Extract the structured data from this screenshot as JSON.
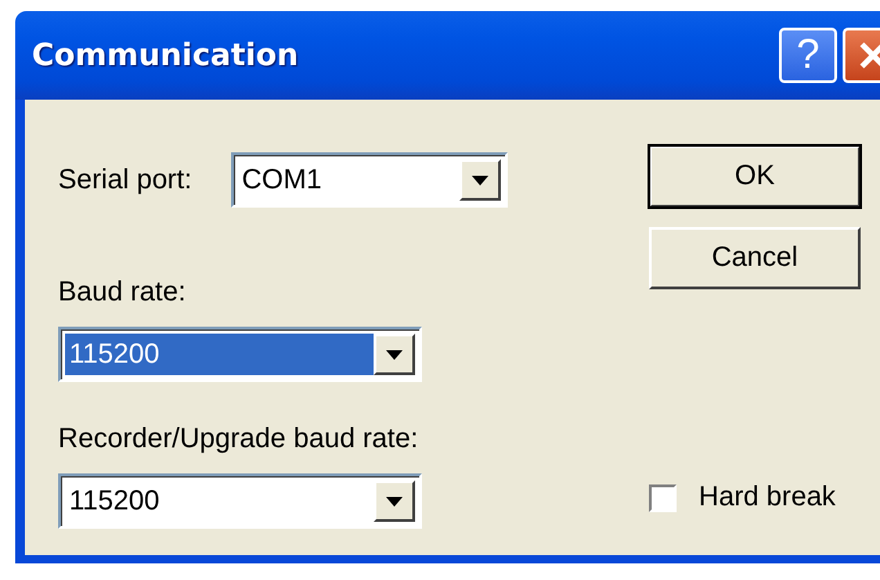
{
  "window": {
    "title": "Communication",
    "help_button": "?"
  },
  "fields": [
    {
      "kind": "inline",
      "label": "Serial port:",
      "value": "COM1",
      "selected": false
    },
    {
      "kind": "stacked",
      "label": "Baud rate:",
      "value": "115200",
      "selected": true
    },
    {
      "kind": "stacked",
      "label": "Recorder/Upgrade baud rate:",
      "value": "115200",
      "selected": false
    }
  ],
  "buttons": [
    {
      "label": "OK",
      "default": true
    },
    {
      "label": "Cancel",
      "default": false
    }
  ],
  "checkbox": {
    "label": "Hard break",
    "checked": false
  }
}
